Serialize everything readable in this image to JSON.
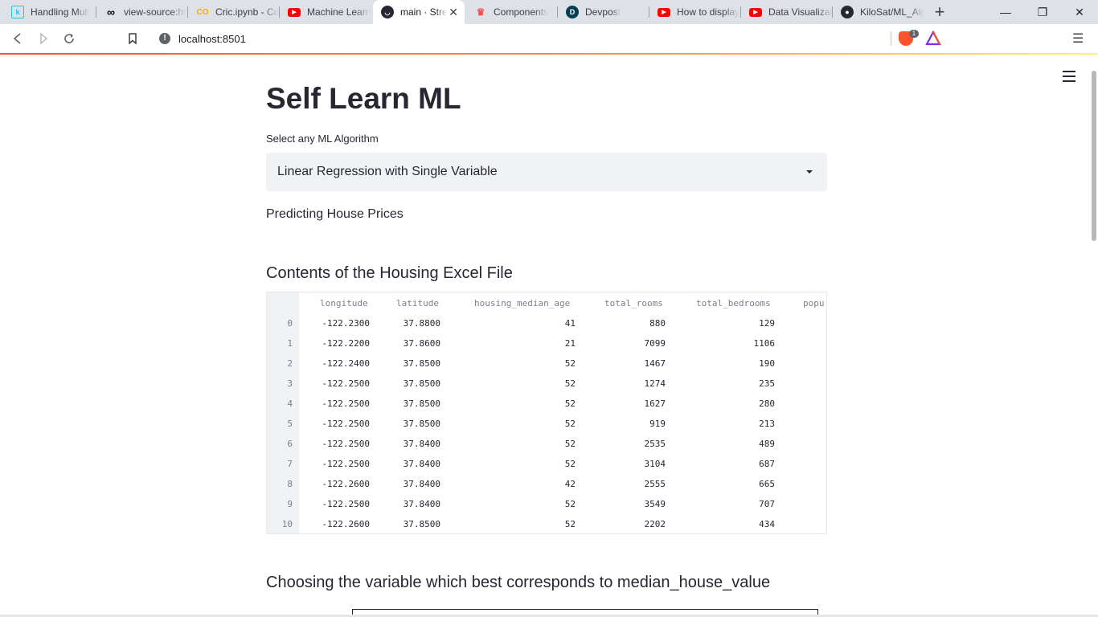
{
  "browser": {
    "tabs": [
      {
        "title": "Handling Mult",
        "icon": "kaggle-icon"
      },
      {
        "title": "view-source:ht",
        "icon": "infinity-icon"
      },
      {
        "title": "Cric.ipynb - Co",
        "icon": "colab-icon"
      },
      {
        "title": "Machine Learn",
        "icon": "youtube-icon"
      },
      {
        "title": "main · Stre",
        "icon": "streamlit-icon",
        "active": true
      },
      {
        "title": "Components",
        "icon": "crown-icon"
      },
      {
        "title": "Devpost",
        "icon": "devpost-icon"
      },
      {
        "title": "How to display",
        "icon": "youtube-icon"
      },
      {
        "title": "Data Visualizat",
        "icon": "youtube-icon"
      },
      {
        "title": "KiloSat/ML_Alg",
        "icon": "github-icon"
      }
    ],
    "url": "localhost:8501",
    "shields_count": "1",
    "accent": "#ff4b4b"
  },
  "page": {
    "title": "Self Learn ML",
    "select_label": "Select any ML Algorithm",
    "select_value": "Linear Regression with Single Variable",
    "subtitle": "Predicting House Prices",
    "section1": "Contents of the Housing Excel File",
    "section2": "Choosing the variable which best corresponds to median_house_value"
  },
  "table": {
    "columns": [
      "longitude",
      "latitude",
      "housing_median_age",
      "total_rooms",
      "total_bedrooms",
      "popu"
    ],
    "rows": [
      {
        "idx": "0",
        "cells": [
          "-122.2300",
          "37.8800",
          "41",
          "880",
          "129"
        ]
      },
      {
        "idx": "1",
        "cells": [
          "-122.2200",
          "37.8600",
          "21",
          "7099",
          "1106"
        ]
      },
      {
        "idx": "2",
        "cells": [
          "-122.2400",
          "37.8500",
          "52",
          "1467",
          "190"
        ]
      },
      {
        "idx": "3",
        "cells": [
          "-122.2500",
          "37.8500",
          "52",
          "1274",
          "235"
        ]
      },
      {
        "idx": "4",
        "cells": [
          "-122.2500",
          "37.8500",
          "52",
          "1627",
          "280"
        ]
      },
      {
        "idx": "5",
        "cells": [
          "-122.2500",
          "37.8500",
          "52",
          "919",
          "213"
        ]
      },
      {
        "idx": "6",
        "cells": [
          "-122.2500",
          "37.8400",
          "52",
          "2535",
          "489"
        ]
      },
      {
        "idx": "7",
        "cells": [
          "-122.2500",
          "37.8400",
          "52",
          "3104",
          "687"
        ]
      },
      {
        "idx": "8",
        "cells": [
          "-122.2600",
          "37.8400",
          "42",
          "2555",
          "665"
        ]
      },
      {
        "idx": "9",
        "cells": [
          "-122.2500",
          "37.8400",
          "52",
          "3549",
          "707"
        ]
      },
      {
        "idx": "10",
        "cells": [
          "-122.2600",
          "37.8500",
          "52",
          "2202",
          "434"
        ]
      }
    ]
  }
}
